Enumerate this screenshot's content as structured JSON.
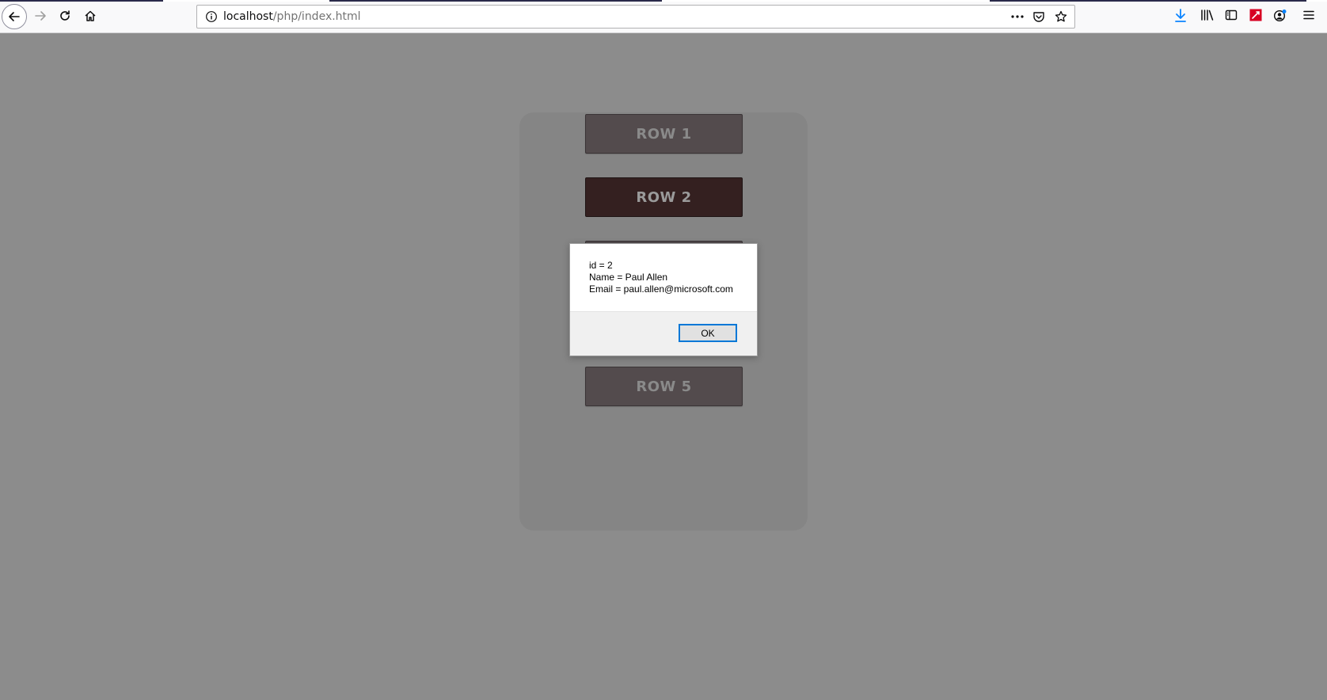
{
  "browser": {
    "url_host": "localhost",
    "url_path": "/php/index.html"
  },
  "page": {
    "rows": [
      {
        "label": "ROW 1",
        "state": "normal"
      },
      {
        "label": "ROW 2",
        "state": "active"
      },
      {
        "label": "ROW 5",
        "state": "normal"
      }
    ]
  },
  "dialog": {
    "lines": [
      "id = 2",
      "Name = Paul Allen",
      "Email = paul.allen@microsoft.com"
    ],
    "ok_label": "OK"
  },
  "icons": {
    "back": "back-arrow-icon",
    "forward": "forward-arrow-icon",
    "reload": "reload-icon",
    "home": "home-icon",
    "site_info": "info-icon",
    "page_actions": "more-dots-icon",
    "pocket": "pocket-icon",
    "bookmark": "star-icon",
    "downloads": "download-icon",
    "library": "library-icon",
    "sidebar": "sidebar-icon",
    "extension": "extension-icon",
    "account": "account-icon",
    "menu": "hamburger-menu-icon"
  },
  "colors": {
    "page_bg": "#8c8c8c",
    "row_normal": "#534b4d",
    "row_active": "#342020",
    "download_accent": "#0a84ff",
    "extension_red": "#d70022",
    "ok_border": "#0078d7"
  }
}
